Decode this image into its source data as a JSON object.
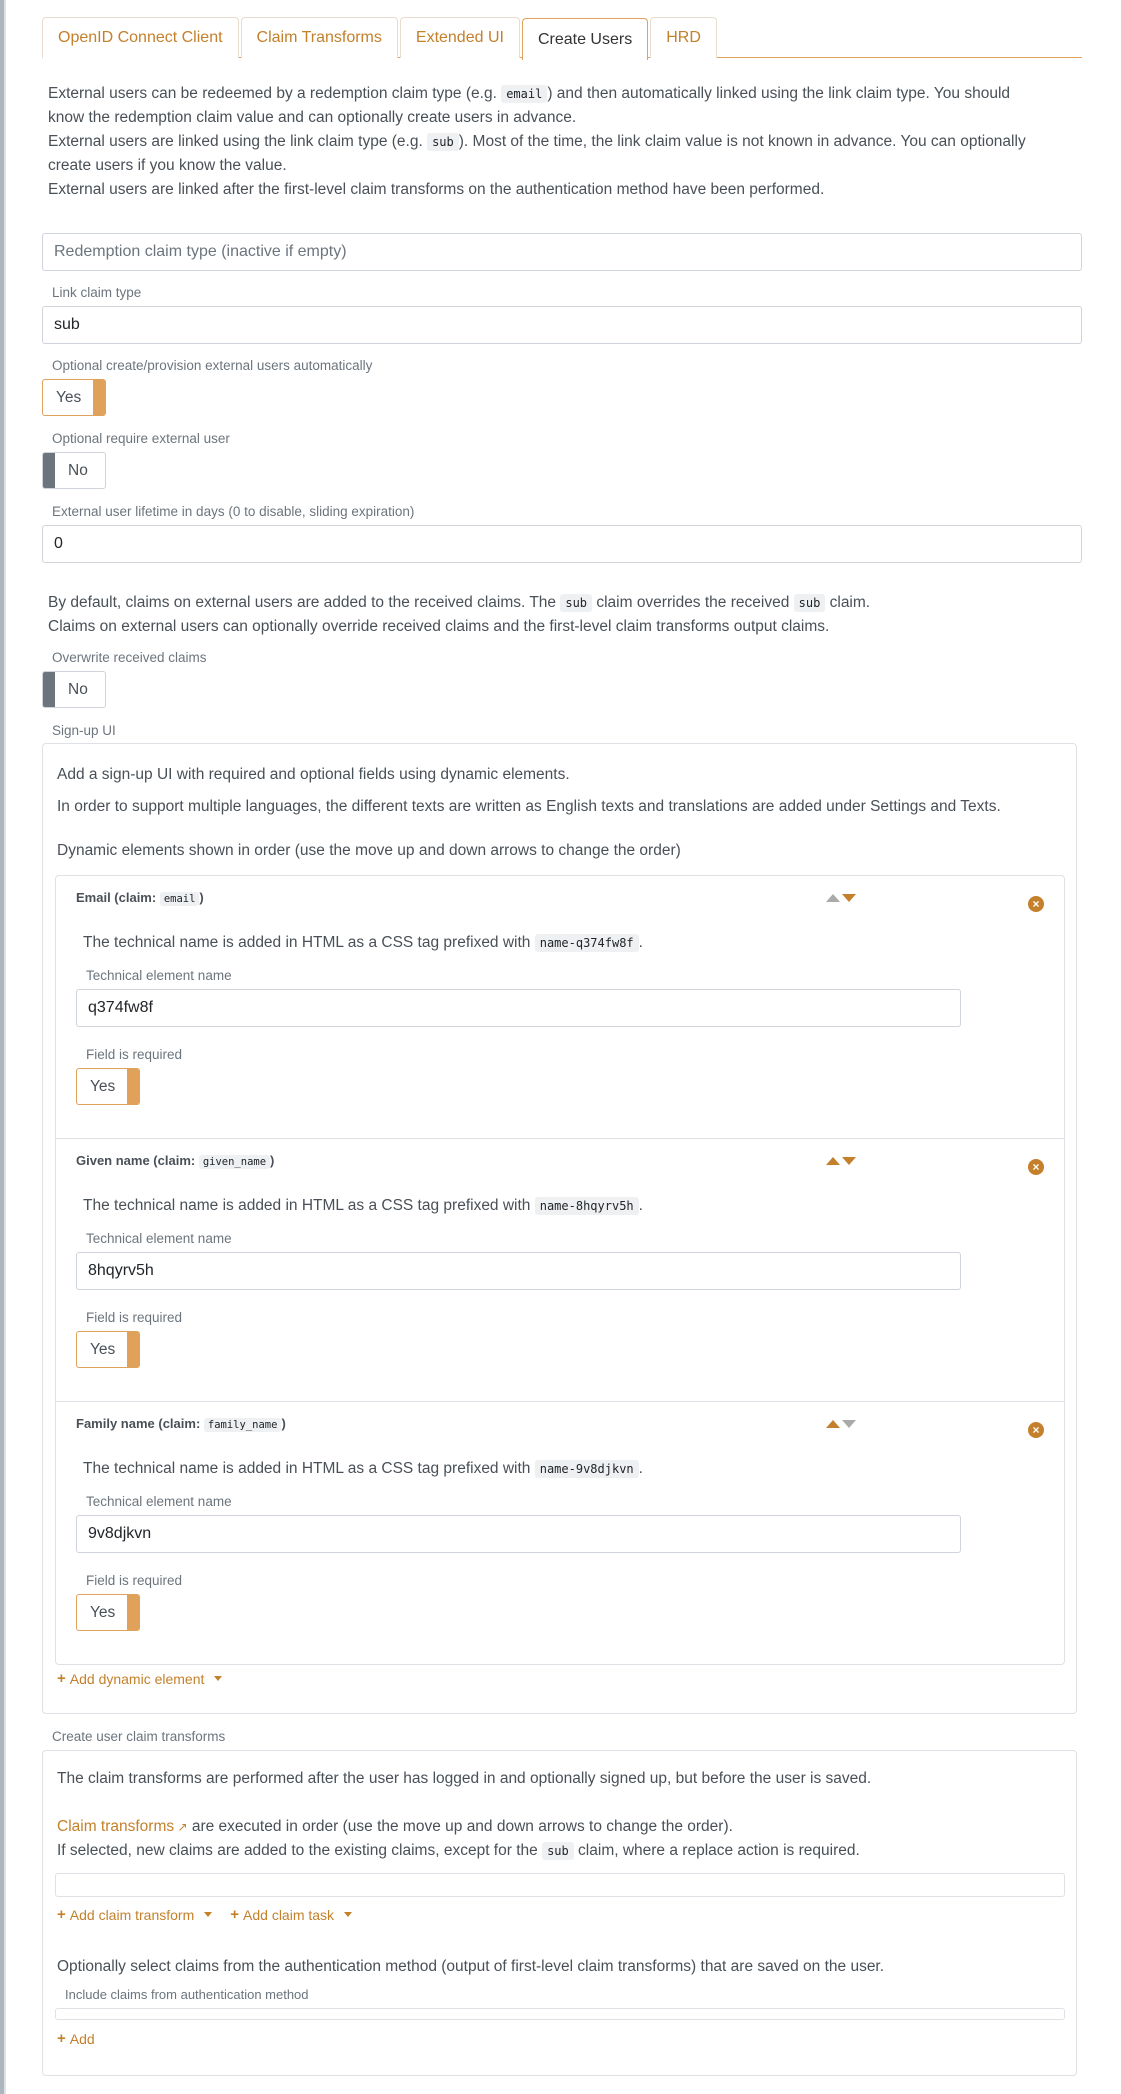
{
  "tabs": [
    {
      "label": "OpenID Connect Client",
      "active": false
    },
    {
      "label": "Claim Transforms",
      "active": false
    },
    {
      "label": "Extended UI",
      "active": false
    },
    {
      "label": "Create Users",
      "active": true
    },
    {
      "label": "HRD",
      "active": false
    }
  ],
  "intro": {
    "p1_a": "External users can be redeemed by a redemption claim type (e.g. ",
    "p1_code": "email",
    "p1_b": ") and then automatically linked using the link claim type. You should",
    "p1_c": "know the redemption claim value and can optionally create users in advance.",
    "p2_a": "External users are linked using the link claim type (e.g. ",
    "p2_code": "sub",
    "p2_b": "). Most of the time, the link claim value is not known in advance. You can optionally",
    "p2_c": "create users if you know the value.",
    "p3": "External users are linked after the first-level claim transforms on the authentication method have been performed."
  },
  "redemption": {
    "placeholder": "Redemption claim type (inactive if empty)",
    "value": ""
  },
  "link_claim": {
    "label": "Link claim type",
    "value": "sub"
  },
  "create_users": {
    "label": "Optional create/provision external users automatically",
    "value": "Yes"
  },
  "require_user": {
    "label": "Optional require external user",
    "value": "No"
  },
  "lifetime": {
    "label": "External user lifetime in days (0 to disable, sliding expiration)",
    "value": "0"
  },
  "claims_info": {
    "l1_a": "By default, claims on external users are added to the received claims. The ",
    "l1_code1": "sub",
    "l1_b": " claim overrides the received ",
    "l1_code2": "sub",
    "l1_c": " claim.",
    "l2": "Claims on external users can optionally override received claims and the first-level claim transforms output claims."
  },
  "overwrite": {
    "label": "Overwrite received claims",
    "value": "No"
  },
  "signup": {
    "label": "Sign-up UI",
    "p1": "Add a sign-up UI with required and optional fields using dynamic elements.",
    "p2": "In order to support multiple languages, the different texts are written as English texts and translations are added under Settings and Texts.",
    "p3": "Dynamic elements shown in order (use the move up and down arrows to change the order)",
    "items": [
      {
        "title": "Email (claim: ",
        "claim": "email",
        "close": ")",
        "tech_text": "The technical name is added in HTML as a CSS tag prefixed with ",
        "prefix": "name-q374fw8f",
        "name_label": "Technical element name",
        "name_value": "q374fw8f",
        "required_label": "Field is required",
        "required_value": "Yes"
      },
      {
        "title": "Given name (claim: ",
        "claim": "given_name",
        "close": ")",
        "tech_text": "The technical name is added in HTML as a CSS tag prefixed with ",
        "prefix": "name-8hqyrv5h",
        "name_label": "Technical element name",
        "name_value": "8hqyrv5h",
        "required_label": "Field is required",
        "required_value": "Yes"
      },
      {
        "title": "Family name (claim: ",
        "claim": "family_name",
        "close": ")",
        "tech_text": "The technical name is added in HTML as a CSS tag prefixed with ",
        "prefix": "name-9v8djkvn",
        "name_label": "Technical element name",
        "name_value": "9v8djkvn",
        "required_label": "Field is required",
        "required_value": "Yes"
      }
    ],
    "add_label": "Add dynamic element"
  },
  "transforms": {
    "label": "Create user claim transforms",
    "p1": "The claim transforms are performed after the user has logged in and optionally signed up, but before the user is saved.",
    "link": "Claim transforms",
    "p2": " are executed in order (use the move up and down arrows to change the order).",
    "p3_a": "If selected, new claims are added to the existing claims, except for the ",
    "p3_code": "sub",
    "p3_b": " claim, where a replace action is required.",
    "add_transform": "Add claim transform",
    "add_task": "Add claim task",
    "p4": "Optionally select claims from the authentication method (output of first-level claim transforms) that are saved on the user.",
    "include_label": "Include claims from authentication method",
    "add": "Add"
  },
  "colors": {
    "accent": "#c4802b",
    "toggle_on": "#e0a15a",
    "toggle_off": "#6c757d"
  }
}
